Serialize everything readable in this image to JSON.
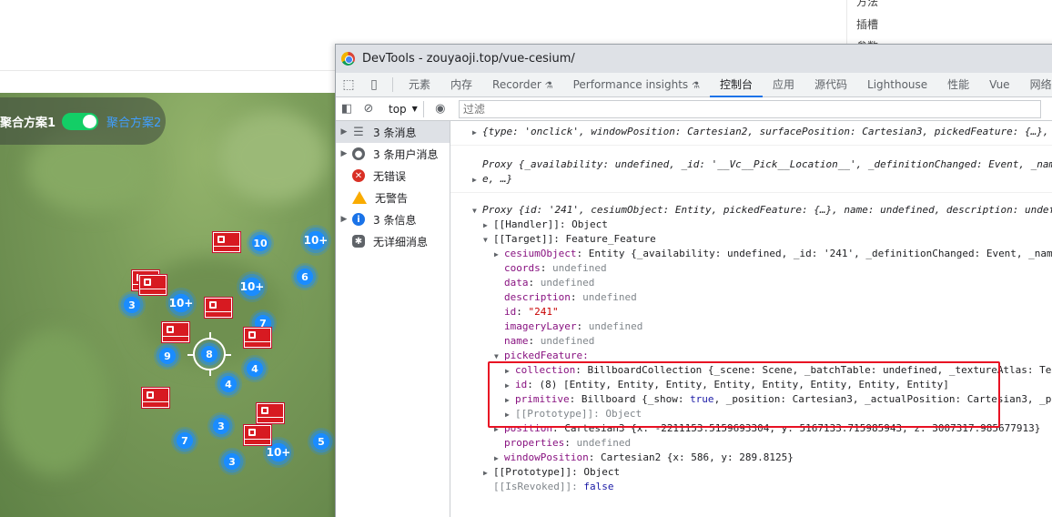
{
  "background": {
    "sidebar_items": [
      "方法",
      "插槽",
      "参数"
    ]
  },
  "map": {
    "toggle": {
      "label_1": "聚合方案1",
      "label_2": "聚合方案2",
      "on": true
    },
    "clusters": [
      "10",
      "10+",
      "6",
      "3",
      "10+",
      "10+",
      "7",
      "9",
      "8",
      "4",
      "4",
      "3",
      "7",
      "3",
      "10+",
      "5"
    ],
    "marker_count": 8
  },
  "devtools": {
    "window_title": "DevTools - zouyaoji.top/vue-cesium/",
    "tabs": [
      "元素",
      "内存",
      "Recorder",
      "Performance insights",
      "控制台",
      "应用",
      "源代码",
      "Lighthouse",
      "性能",
      "Vue",
      "网络"
    ],
    "active_tab": "控制台",
    "toolbar": {
      "context": "top",
      "filter_placeholder": "过滤"
    },
    "sidebar": [
      {
        "label": "3 条消息",
        "icon": "list-icon",
        "expandable": true,
        "selected": true
      },
      {
        "label": "3 条用户消息",
        "icon": "user-icon",
        "expandable": true
      },
      {
        "label": "无错误",
        "icon": "error-icon",
        "expandable": false
      },
      {
        "label": "无警告",
        "icon": "warning-icon",
        "expandable": false
      },
      {
        "label": "3 条信息",
        "icon": "info-icon",
        "expandable": true
      },
      {
        "label": "无详细消息",
        "icon": "verbose-icon",
        "expandable": false
      }
    ],
    "console": {
      "msg1": "{type: 'onclick', windowPosition: Cartesian2, surfacePosition: Cartesian3, pickedFeature: {…},",
      "msg2a": "Proxy {_availability: undefined, _id: '__Vc__Pick__Location__', _definitionChanged: Event, _nam",
      "msg2b": "e, …}",
      "msg3": "Proxy {id: '241', cesiumObject: Entity, pickedFeature: {…}, name: undefined, description: undef",
      "handler": "[[Handler]]: Object",
      "target": "[[Target]]: Feature_Feature",
      "cesiumObject_key": "cesiumObject",
      "cesiumObject_val": ": Entity {_availability: undefined, _id: '241', _definitionChanged: Event, _name",
      "coords": "coords",
      "data": "data",
      "description": "description",
      "id_key": "id",
      "id_val": "\"241\"",
      "imageryLayer": "imageryLayer",
      "name": "name",
      "undefined": "undefined",
      "pickedFeature": "pickedFeature:",
      "collection_key": "collection",
      "collection_val": ": BillboardCollection {_scene: Scene, _batchTable: undefined, _textureAtlas: Tex",
      "id2_key": "id",
      "id2_val": ": (8) [Entity, Entity, Entity, Entity, Entity, Entity, Entity, Entity]",
      "primitive_key": "primitive",
      "primitive_val_1": ": Billboard {_show: ",
      "primitive_true": "true",
      "primitive_val_2": ", _position: Cartesian3, _actualPosition: Cartesian3, _pi",
      "prototype1": "[[Prototype]]: Object",
      "position_key": "position",
      "position_val": ": Cartesian3 {x: -2211153.5159693304, y: 5167133.715985943, z: 3007317.985677913}",
      "properties": "properties",
      "windowPosition_key": "windowPosition",
      "windowPosition_val": ": Cartesian2 {x: 586, y: 289.8125}",
      "prototype2": "[[Prototype]]: Object",
      "isRevoked": "[[IsRevoked]]:",
      "false": "false",
      "src": "["
    }
  }
}
